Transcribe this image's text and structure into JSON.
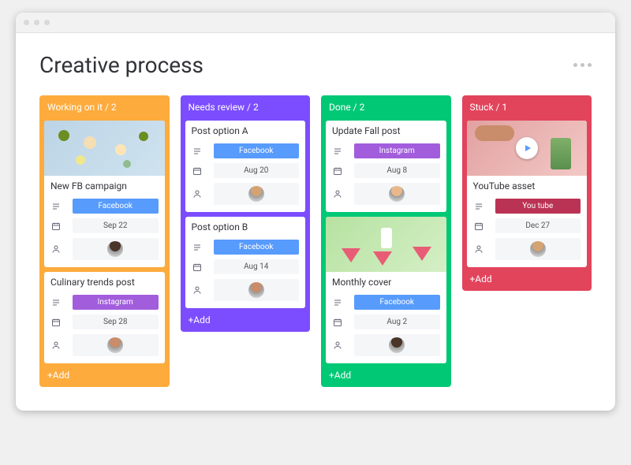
{
  "page": {
    "title": "Creative process"
  },
  "addLabel": "+Add",
  "colors": {
    "working": "#fdab3d",
    "review": "#7c4dff",
    "done": "#00c875",
    "stuck": "#e2445c",
    "facebook": "#579bfc",
    "instagram": "#a25ddc",
    "youtube": "#bb3354"
  },
  "columns": [
    {
      "id": "working",
      "title": "Working on it / 2",
      "color": "working",
      "cards": [
        {
          "id": "new-fb",
          "image": "fruits",
          "title": "New FB campaign",
          "platform": {
            "label": "Facebook",
            "color": "facebook"
          },
          "date": "Sep 22",
          "avatar": "a1"
        },
        {
          "id": "culinary",
          "title": "Culinary trends post",
          "platform": {
            "label": "Instagram",
            "color": "instagram"
          },
          "date": "Sep 28",
          "avatar": "a2"
        }
      ]
    },
    {
      "id": "review",
      "title": "Needs review / 2",
      "color": "review",
      "cards": [
        {
          "id": "opt-a",
          "title": "Post option A",
          "platform": {
            "label": "Facebook",
            "color": "facebook"
          },
          "date": "Aug 20",
          "avatar": "a3"
        },
        {
          "id": "opt-b",
          "title": "Post option B",
          "platform": {
            "label": "Facebook",
            "color": "facebook"
          },
          "date": "Aug 14",
          "avatar": "a2"
        }
      ]
    },
    {
      "id": "done",
      "title": "Done / 2",
      "color": "done",
      "cards": [
        {
          "id": "fall",
          "title": "Update Fall post",
          "platform": {
            "label": "Instagram",
            "color": "instagram"
          },
          "date": "Aug 8",
          "avatar": "a4"
        },
        {
          "id": "monthly",
          "image": "melon",
          "title": "Monthly cover",
          "platform": {
            "label": "Facebook",
            "color": "facebook"
          },
          "date": "Aug 2",
          "avatar": "a1"
        }
      ]
    },
    {
      "id": "stuck",
      "title": "Stuck / 1",
      "color": "stuck",
      "cards": [
        {
          "id": "yt",
          "image": "video",
          "hasPlay": true,
          "title": "YouTube asset",
          "platform": {
            "label": "You tube",
            "color": "youtube"
          },
          "date": "Dec 27",
          "avatar": "a3"
        }
      ]
    }
  ],
  "avatars": {
    "a1": "#4a3528",
    "a2": "#c98d6b",
    "a3": "#d4a373",
    "a4": "#e8b88a"
  }
}
